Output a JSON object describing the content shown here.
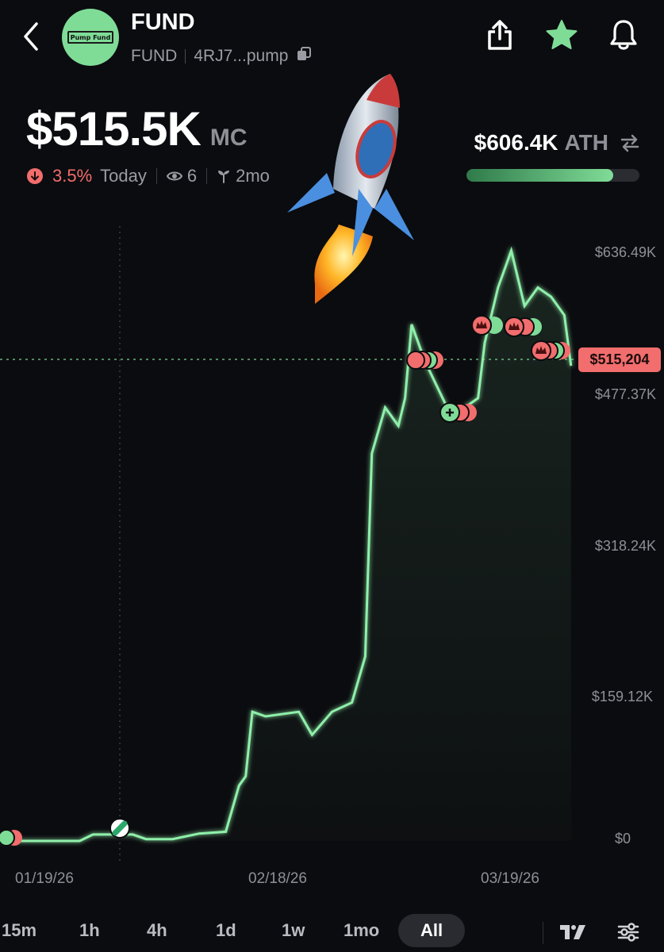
{
  "header": {
    "token_name": "FUND",
    "token_symbol": "FUND",
    "address": "4RJ7...pump",
    "avatar_text": "Pump Fund"
  },
  "market": {
    "value": "$515.5K",
    "label": "MC",
    "change_pct": "3.5%",
    "change_period": "Today",
    "watchers": "6",
    "age": "2mo"
  },
  "ath": {
    "value": "$606.4K",
    "label": "ATH",
    "progress": 0.85
  },
  "chart_data": {
    "type": "line",
    "y_ticks": [
      "$636.49K",
      "$477.37K",
      "$318.24K",
      "$159.12K",
      "$0"
    ],
    "x_ticks": [
      "01/19/26",
      "02/18/26",
      "03/19/26"
    ],
    "current_price_label": "$515,204",
    "ylim": [
      0,
      636490
    ],
    "line_color": "#8ff0aa",
    "points": [
      [
        0,
        0
      ],
      [
        0.12,
        0
      ],
      [
        0.14,
        7000
      ],
      [
        0.2,
        7000
      ],
      [
        0.22,
        2000
      ],
      [
        0.26,
        2000
      ],
      [
        0.3,
        8000
      ],
      [
        0.34,
        10000
      ],
      [
        0.36,
        60000
      ],
      [
        0.37,
        70000
      ],
      [
        0.38,
        140000
      ],
      [
        0.4,
        135000
      ],
      [
        0.45,
        140000
      ],
      [
        0.47,
        115000
      ],
      [
        0.5,
        140000
      ],
      [
        0.53,
        150000
      ],
      [
        0.55,
        200000
      ],
      [
        0.56,
        420000
      ],
      [
        0.58,
        470000
      ],
      [
        0.6,
        450000
      ],
      [
        0.61,
        480000
      ],
      [
        0.62,
        560000
      ],
      [
        0.64,
        520000
      ],
      [
        0.66,
        490000
      ],
      [
        0.68,
        460000
      ],
      [
        0.7,
        470000
      ],
      [
        0.72,
        480000
      ],
      [
        0.73,
        540000
      ],
      [
        0.75,
        600000
      ],
      [
        0.77,
        640000
      ],
      [
        0.79,
        580000
      ],
      [
        0.81,
        600000
      ],
      [
        0.83,
        590000
      ],
      [
        0.85,
        570000
      ],
      [
        0.86,
        515204
      ]
    ]
  },
  "timeframes": [
    "15m",
    "1h",
    "4h",
    "1d",
    "1w",
    "1mo",
    "All"
  ],
  "active_timeframe": "All",
  "colors": {
    "accent": "#7fdc97",
    "negative": "#f26d6d",
    "background": "#0b0c0f"
  },
  "icons": {
    "back": "chevron-left-icon",
    "share": "share-icon",
    "star": "star-icon",
    "bell": "bell-icon",
    "swap": "swap-arrows-icon",
    "rocket": "rocket-icon"
  }
}
